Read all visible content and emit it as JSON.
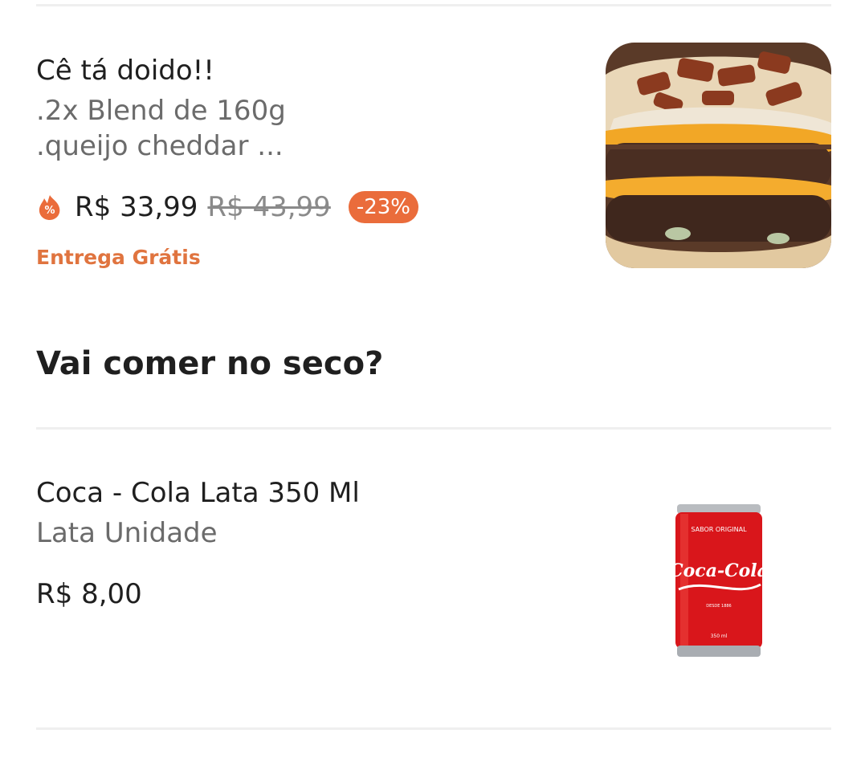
{
  "items": [
    {
      "name": "Cê tá doido!!",
      "description_line1": ".2x Blend de 160g",
      "description_line2": ".queijo cheddar ...",
      "price": "R$ 33,99",
      "old_price": "R$ 43,99",
      "discount": "-23%",
      "delivery": "Entrega Grátis",
      "promo_icon": "discount-flame-icon",
      "image": "burger-image"
    }
  ],
  "section": {
    "title": "Vai comer no seco?"
  },
  "drinks": [
    {
      "name": "Coca - Cola Lata 350 Ml",
      "description": "Lata Unidade",
      "price": "R$ 8,00",
      "image": "coca-cola-can-image",
      "can_text": {
        "top": "SABOR ORIGINAL",
        "brand": "Coca-Cola",
        "since": "DESDE 1886",
        "volume": "350 ml"
      }
    }
  ],
  "colors": {
    "accent": "#ea6c3b",
    "delivery": "#e0743f",
    "text": "#1f1f1f",
    "muted": "#6b6b6b",
    "divider": "#efefef"
  }
}
